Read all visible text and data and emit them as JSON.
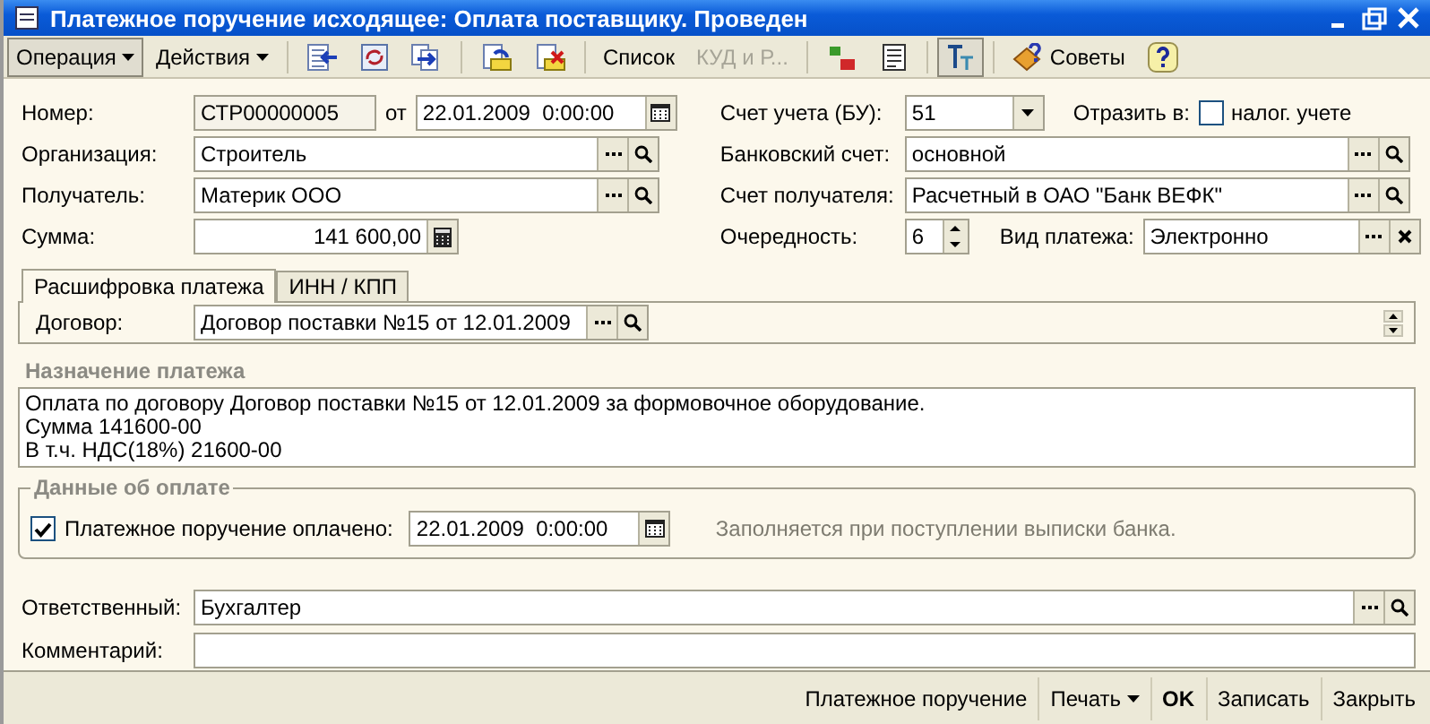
{
  "window": {
    "title": "Платежное поручение исходящее: Оплата поставщику. Проведен"
  },
  "toolbar": [
    {
      "kind": "menu",
      "label": "Операция",
      "pressed": true
    },
    {
      "kind": "menu",
      "label": "Действия",
      "pressed": false
    },
    {
      "kind": "separator"
    },
    {
      "kind": "icon",
      "pressed": false
    },
    {
      "kind": "icon",
      "pressed": false
    },
    {
      "kind": "icon",
      "pressed": false
    },
    {
      "kind": "separator"
    },
    {
      "kind": "icon",
      "pressed": false
    },
    {
      "kind": "icon",
      "pressed": false
    },
    {
      "kind": "separator"
    },
    {
      "kind": "text",
      "label": "Список",
      "disabled": false
    },
    {
      "kind": "text",
      "label": "КУД и Р...",
      "disabled": true
    },
    {
      "kind": "separator"
    },
    {
      "kind": "icon",
      "pressed": false
    },
    {
      "kind": "icon",
      "pressed": false
    },
    {
      "kind": "separator"
    },
    {
      "kind": "icon",
      "pressed": true
    },
    {
      "kind": "separator"
    },
    {
      "kind": "help",
      "label": "Советы"
    },
    {
      "kind": "icon",
      "pressed": false
    }
  ],
  "header": {
    "number": {
      "label": "Номер:",
      "value": "СТР00000005"
    },
    "date": {
      "label": "от",
      "value": "22.01.2009  0:00:00"
    },
    "organization": {
      "label": "Организация:",
      "value": "Строитель"
    },
    "recipient": {
      "label": "Получатель:",
      "value": "Материк ООО"
    },
    "amount": {
      "label": "Сумма:",
      "value": "141 600,00"
    },
    "account": {
      "label": "Счет учета (БУ):",
      "value": "51"
    },
    "reflect": {
      "label": "Отразить в:",
      "option": "налог. учете",
      "checked": false
    },
    "bank_account": {
      "label": "Банковский счет:",
      "value": "основной"
    },
    "recipient_account": {
      "label": "Счет получателя:",
      "value": "Расчетный в ОАО \"Банк ВЕФК\""
    },
    "priority": {
      "label": "Очередность:",
      "value": "6"
    },
    "payment_type": {
      "label": "Вид платежа:",
      "value": "Электронно"
    }
  },
  "tabs": [
    {
      "label": "Расшифровка платежа",
      "selected": true
    },
    {
      "label": "ИНН / КПП",
      "selected": false
    }
  ],
  "contract": {
    "label": "Договор:",
    "value": "Договор поставки №15 от 12.01.2009"
  },
  "purpose": {
    "title": "Назначение платежа",
    "lines": [
      "Оплата по договору Договор поставки №15 от 12.01.2009 за формовочное оборудование.",
      "Сумма 141600-00",
      "В т.ч. НДС(18%) 21600-00"
    ]
  },
  "payment": {
    "title": "Данные об оплате",
    "label": "Платежное поручение оплачено:",
    "checked": true,
    "date": "22.01.2009  0:00:00",
    "hint": "Заполняется при поступлении выписки банка."
  },
  "responsible": {
    "label": "Ответственный:",
    "value": "Бухгалтер"
  },
  "comment": {
    "label": "Комментарий:"
  },
  "footer": [
    {
      "kind": "text",
      "label": "Платежное поручение"
    },
    {
      "kind": "menu",
      "label": "Печать"
    },
    {
      "kind": "default",
      "label": "OK"
    },
    {
      "kind": "text",
      "label": "Записать"
    },
    {
      "kind": "text",
      "label": "Закрыть"
    }
  ]
}
